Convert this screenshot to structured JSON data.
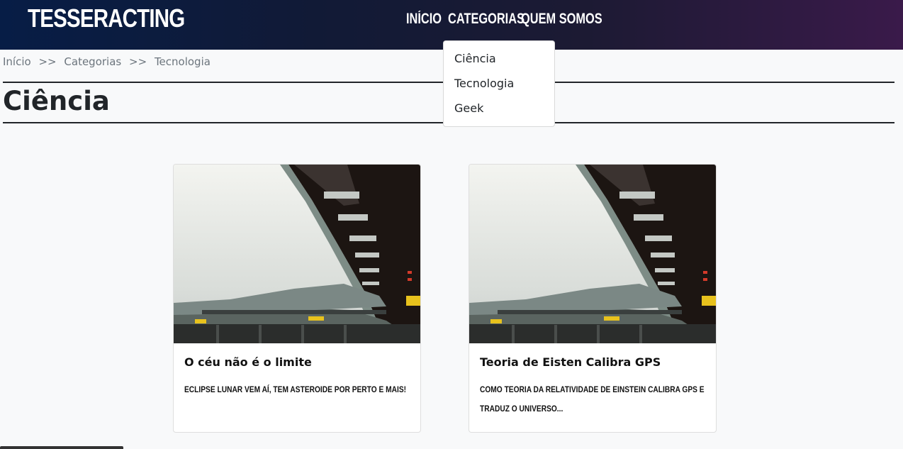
{
  "brand": "TESSERACTING",
  "nav": {
    "items": [
      "INÍCIO",
      "CATEGORIAS",
      "QUEM SOMOS"
    ]
  },
  "dropdown": {
    "items": [
      "Ciência",
      "Tecnologia",
      "Geek"
    ]
  },
  "breadcrumb": {
    "items": [
      "Início",
      ">>",
      "Categorias",
      ">>",
      "Tecnologia"
    ]
  },
  "page_title": "Ciência",
  "cards": [
    {
      "title": "O céu não é o limite",
      "text": "Eclipse lunar vem aí, tem asteroide por perto e mais!"
    },
    {
      "title": "Teoria de Eisten Calibra GPS",
      "text": "Como teoria da relatividade de Einstein calibra GPS e traduz o universo..."
    }
  ],
  "colors": {
    "header_gradient_start": "#071d46",
    "header_gradient_end": "#3a1a4a",
    "page_background": "#f8f9fa",
    "text": "#212529",
    "muted": "#6c757d"
  }
}
